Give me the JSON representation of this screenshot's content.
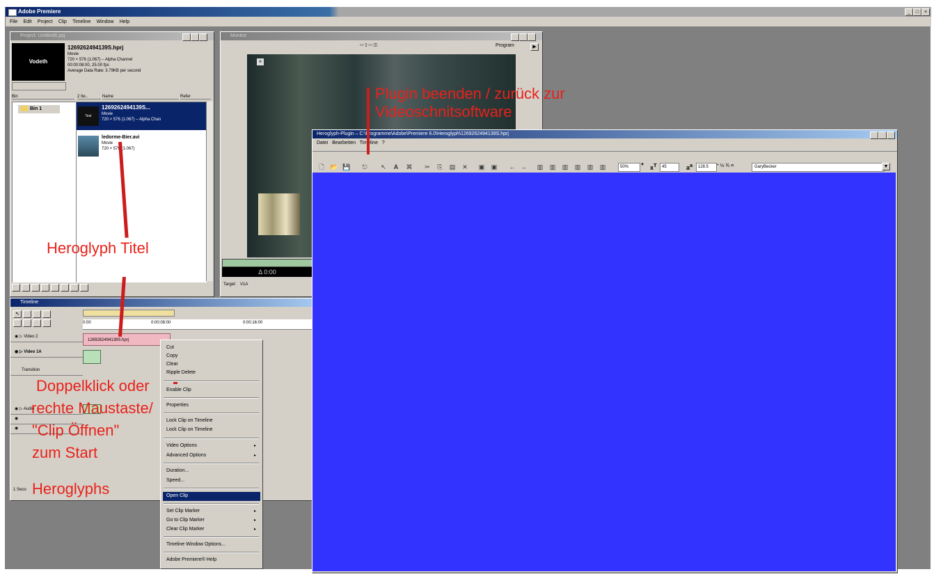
{
  "app": {
    "title": "Adobe Premiere",
    "menu": [
      "File",
      "Edit",
      "Project",
      "Clip",
      "Timeline",
      "Window",
      "Help"
    ],
    "controls": [
      "_",
      "□",
      "×"
    ]
  },
  "project": {
    "title": "Project: Untitled6.ppj",
    "preview_label": "Vodeth",
    "clip_name": "1269262494139S.hprj",
    "clip_type": "Movie",
    "clip_dims": "720 × 576 (1.067) – Alpha Channel",
    "clip_duration": "00:00:08:00, 25.00 fps",
    "clip_rate": "Average Data Rate: 3.79KB per second",
    "col_bin": "Bin",
    "col_num": "2 Ite..",
    "col_name": "Name",
    "col_ref": "Refer",
    "bin_label": "Bin 1",
    "item1_name": "1269262494139S...",
    "item1_type": "Movie",
    "item1_dims": "720 × 576 (1.067) – Alpha Chan",
    "item1_thumb": "Text",
    "item2_name": "ledorme-Bier.avi",
    "item2_type": "Movie",
    "item2_dims": "720 × 576 (1.067)"
  },
  "monitor": {
    "title": "Monitor",
    "program_label": "Program",
    "timecode": "Δ 0:00",
    "target_label": "Target:",
    "target_value": "V1A"
  },
  "timeline": {
    "title": "Timeline",
    "time1": "0:00",
    "time2": "0:00:08:00",
    "time3": "0:00:16:00",
    "track_video2": "Video 2",
    "track_video1": "Video 1A",
    "track_transition": "Transition",
    "track_audio": "Audio",
    "clip_label": "1269262494139S.hprj",
    "bottom_label": "1 Seco"
  },
  "context_menu": {
    "items": [
      "Cut",
      "Copy",
      "Clear",
      "Ripple Delete",
      "Enable Clip",
      "Properties",
      "Lock Clip on Timeline",
      "Lock Clip on Timeline",
      "Video Options",
      "Advanced Options",
      "Duration...",
      "Speed...",
      "Open Clip",
      "Set Clip Marker",
      "Go to Clip Marker",
      "Clear Clip Marker",
      "Timeline Window Options...",
      "Adobe Premiere® Help"
    ],
    "highlighted": "Open Clip"
  },
  "heroglyph": {
    "title": "Heroglyph-Plugin – C:\\Programme\\Adobe\\Premiere 6.0\\Heroglyph\\1269262494139S.hprj",
    "menu": [
      "Datei",
      "Bearbeiten",
      "Timeline",
      "?"
    ],
    "zoom": "50%",
    "value1": "45",
    "value2": "128.5",
    "font": "GaryBecker",
    "canvas_color": "#3333ff"
  },
  "annotations": {
    "plugin_line1": "Plugin beenden / zurück zur",
    "plugin_line2": "Videoschnitsoftware",
    "heroglyph_titel": "Heroglyph Titel",
    "doppel_1": "Doppelklick oder",
    "doppel_2": "rechte Maustaste/",
    "doppel_3": "\"Clip Öffnen\"",
    "doppel_4": "zum Start",
    "doppel_5": "Heroglyphs",
    "color": "#e8211a"
  }
}
